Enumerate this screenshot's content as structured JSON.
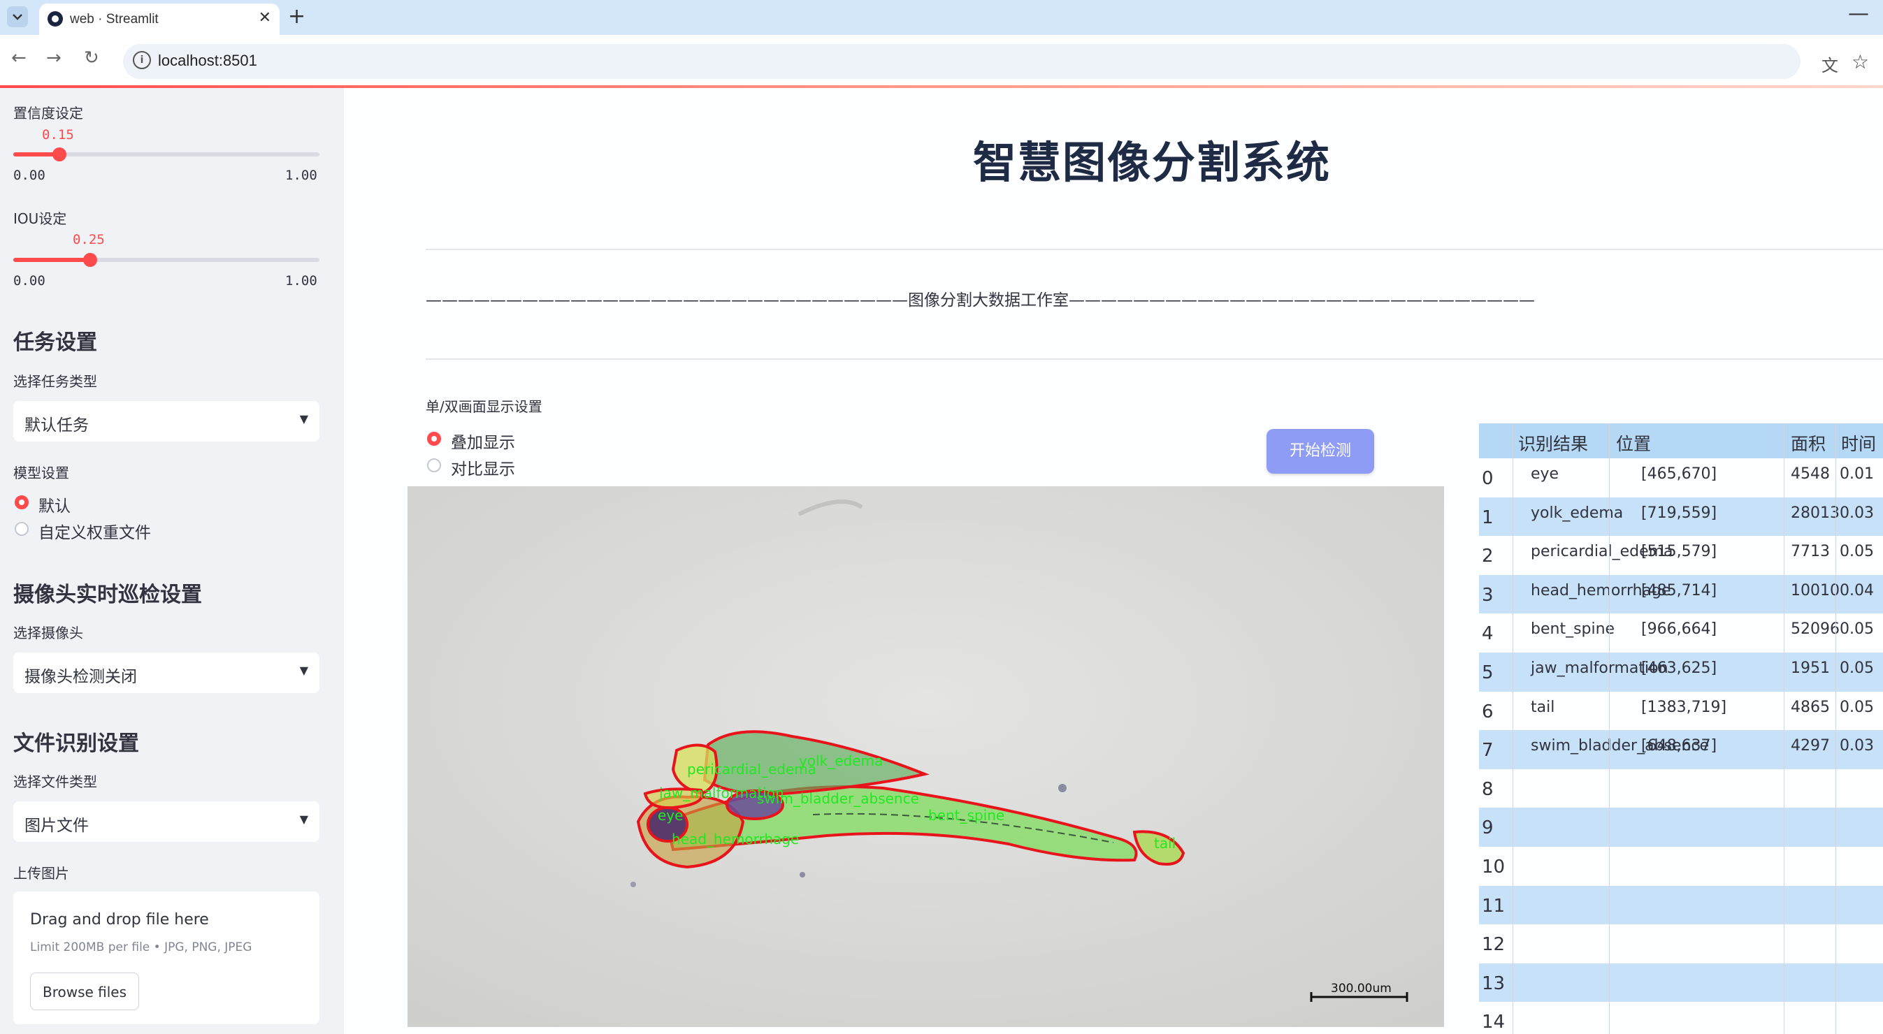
{
  "browser": {
    "tab_title": "web · Streamlit",
    "url": "localhost:8501"
  },
  "sidebar": {
    "confidence": {
      "label": "置信度设定",
      "value": "0.15",
      "level": 0.15,
      "min": "0.00",
      "max": "1.00"
    },
    "iou": {
      "label": "IOU设定",
      "value": "0.25",
      "level": 0.25,
      "min": "0.00",
      "max": "1.00"
    },
    "task_heading": "任务设置",
    "task_type_label": "选择任务类型",
    "task_type_value": "默认任务",
    "model_label": "模型设置",
    "model_options": [
      "默认",
      "自定义权重文件"
    ],
    "camera_heading": "摄像头实时巡检设置",
    "camera_label": "选择摄像头",
    "camera_value": "摄像头检测关闭",
    "file_heading": "文件识别设置",
    "file_type_label": "选择文件类型",
    "file_type_value": "图片文件",
    "upload_label": "上传图片",
    "upload_title": "Drag and drop file here",
    "upload_limit": "Limit 200MB per file • JPG, PNG, JPEG",
    "browse_label": "Browse files"
  },
  "main": {
    "title": "智慧图像分割系统",
    "subtitle_line": "——————————————————————————————图像分割大数据工作室—————————————————————————————",
    "display_mode_label": "单/双画面显示设置",
    "display_options": [
      "叠加显示",
      "对比显示"
    ],
    "start_button": "开始检测",
    "scale_bar": "300.00um",
    "overlay_labels": {
      "eye": "eye",
      "yolk_edema": "yolk_edema",
      "pericardial_edema": "pericardial_edema",
      "jaw": "jaw_malformation",
      "swim": "swim_bladder_absence",
      "bent": "bent_spine",
      "head": "head_hemorrhage",
      "tail": "tail"
    }
  },
  "table": {
    "headers": [
      "识别结果",
      "位置",
      "面积",
      "时间"
    ],
    "rows": [
      {
        "index": "0",
        "label": "eye",
        "pos": "[465,670]",
        "area": "4548",
        "time": "0.01"
      },
      {
        "index": "1",
        "label": "yolk_edema",
        "pos": "[719,559]",
        "area": "28013",
        "time": "0.03"
      },
      {
        "index": "2",
        "label": "pericardial_edema",
        "pos": "[515,579]",
        "area": "7713",
        "time": "0.05"
      },
      {
        "index": "3",
        "label": "head_hemorrhage",
        "pos": "[485,714]",
        "area": "10010",
        "time": "0.04"
      },
      {
        "index": "4",
        "label": "bent_spine",
        "pos": "[966,664]",
        "area": "52096",
        "time": "0.05"
      },
      {
        "index": "5",
        "label": "jaw_malformation",
        "pos": "[463,625]",
        "area": "1951",
        "time": "0.05"
      },
      {
        "index": "6",
        "label": "tail",
        "pos": "[1383,719]",
        "area": "4865",
        "time": "0.05"
      },
      {
        "index": "7",
        "label": "swim_bladder_absence",
        "pos": "[648,637]",
        "area": "4297",
        "time": "0.03"
      },
      {
        "index": "8",
        "label": "",
        "pos": "",
        "area": "",
        "time": ""
      },
      {
        "index": "9",
        "label": "",
        "pos": "",
        "area": "",
        "time": ""
      },
      {
        "index": "10",
        "label": "",
        "pos": "",
        "area": "",
        "time": ""
      },
      {
        "index": "11",
        "label": "",
        "pos": "",
        "area": "",
        "time": ""
      },
      {
        "index": "12",
        "label": "",
        "pos": "",
        "area": "",
        "time": ""
      },
      {
        "index": "13",
        "label": "",
        "pos": "",
        "area": "",
        "time": ""
      },
      {
        "index": "14",
        "label": "",
        "pos": "",
        "area": "",
        "time": ""
      }
    ]
  },
  "colors": {
    "accent": "#ff4b4b",
    "start_button": "#8f9cf6",
    "table_header": "#b5d8f4",
    "table_alt_row": "#c7e1f8",
    "mask_outline": "#e8141c",
    "mask_fill": "#7fdc5e",
    "mask_label": "#22e822"
  },
  "icons": [
    "tab-list-icon",
    "streamlit-favicon",
    "close-icon",
    "plus-icon",
    "minimize-icon",
    "back-icon",
    "forward-icon",
    "reload-icon",
    "site-info-icon",
    "translate-icon",
    "star-icon",
    "chevron-down-icon"
  ]
}
